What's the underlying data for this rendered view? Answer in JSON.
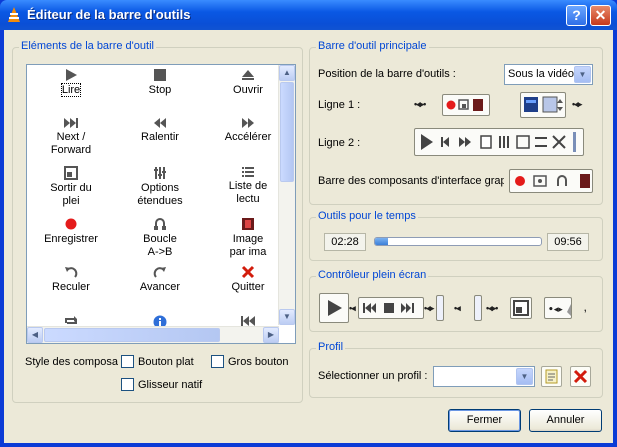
{
  "window": {
    "title": "Éditeur de la barre d'outils"
  },
  "elements": {
    "title": "Eléments de la barre d'outil",
    "items": [
      {
        "label": "Lire",
        "icon": "play-icon"
      },
      {
        "label": "Stop",
        "icon": "stop-icon"
      },
      {
        "label": "Ouvrir",
        "icon": "eject-icon"
      },
      {
        "label": "Next / Forward",
        "icon": "next-icon"
      },
      {
        "label": "Ralentir",
        "icon": "slower-icon"
      },
      {
        "label": "Accélérer",
        "icon": "faster-icon"
      },
      {
        "label": "Sortir du plei",
        "icon": "exit-fullscreen-icon"
      },
      {
        "label": "Options étendues",
        "icon": "extended-settings-icon"
      },
      {
        "label": "Liste de lectu",
        "icon": "playlist-icon"
      },
      {
        "label": "Enregistrer",
        "icon": "record-icon"
      },
      {
        "label": "Boucle A->B",
        "icon": "ab-loop-icon"
      },
      {
        "label": "Image par ima",
        "icon": "frame-by-frame-icon"
      },
      {
        "label": "Reculer",
        "icon": "skip-back-icon"
      },
      {
        "label": "Avancer",
        "icon": "skip-forward-icon"
      },
      {
        "label": "Quitter",
        "icon": "quit-icon"
      }
    ],
    "partial_row_icons": [
      "loop-icon",
      "info-icon",
      "previous-icon"
    ],
    "style_label": "Style des composa",
    "options": [
      {
        "label": "Bouton plat",
        "checked": false
      },
      {
        "label": "Gros bouton",
        "checked": false
      },
      {
        "label": "Glisseur natif",
        "checked": false
      }
    ]
  },
  "main_toolbar": {
    "title": "Barre d'outil principale",
    "position_label": "Position de la barre d'outils :",
    "position_value": "Sous la vidéo",
    "line1_label": "Ligne 1 :",
    "line2_label": "Ligne 2 :",
    "interface_bar_label": "Barre des composants d'interface grap"
  },
  "time_tools": {
    "title": "Outils pour le temps",
    "elapsed": "02:28",
    "total": "09:56",
    "progress_percent": 8
  },
  "fullscreen": {
    "title": "Contrôleur plein écran"
  },
  "profile": {
    "title": "Profil",
    "select_label": "Sélectionner un profil :",
    "select_value": ""
  },
  "buttons": {
    "ok": "Fermer",
    "cancel": "Annuler"
  },
  "colors": {
    "titlebar": "#0a58e4",
    "group_title": "#0046d5",
    "dialog_bg": "#ece9d8",
    "record": "#e41b1b"
  }
}
